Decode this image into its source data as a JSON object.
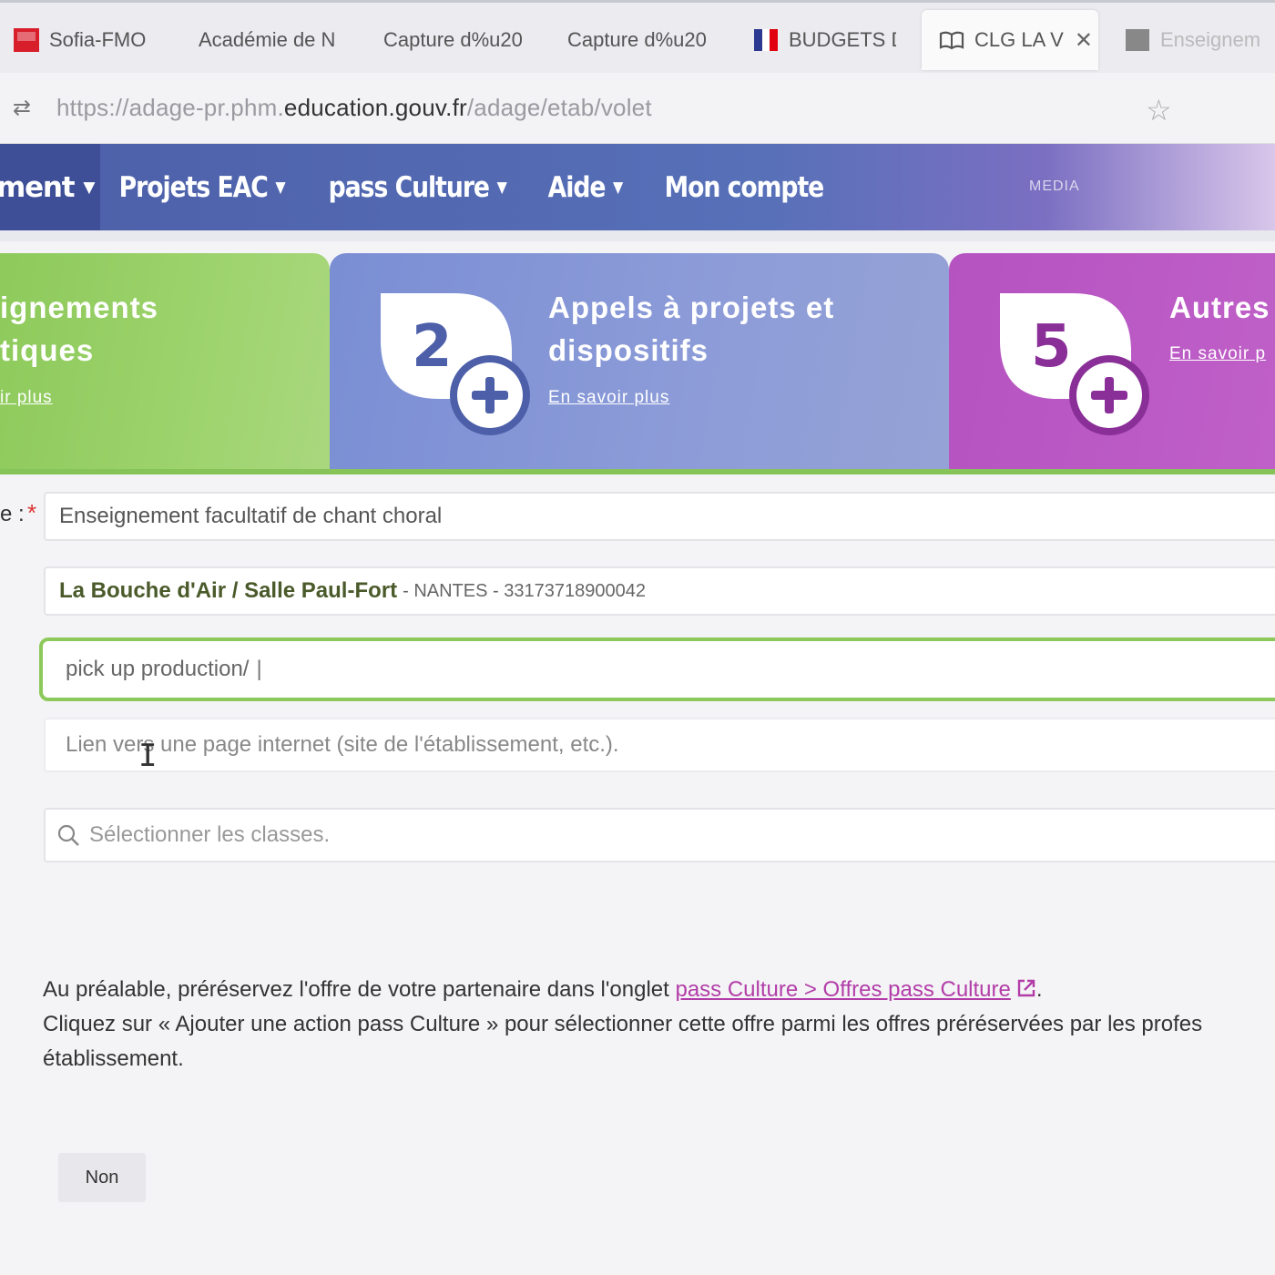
{
  "tabs": [
    {
      "label": "Sofia-FMO",
      "icon": "sofia-logo-icon",
      "active": false
    },
    {
      "label": "Académie de N",
      "icon": "",
      "active": false
    },
    {
      "label": "Capture d%u20",
      "icon": "",
      "active": false
    },
    {
      "label": "Capture d%u20",
      "icon": "",
      "active": false
    },
    {
      "label": "BUDGETS D",
      "icon": "french-flag-icon",
      "active": false
    },
    {
      "label": "CLG LA V",
      "icon": "book-icon",
      "active": true
    },
    {
      "label": "Enseignem",
      "icon": "page-icon",
      "active": false
    }
  ],
  "address": {
    "prefix": "https://adage-pr.phm.",
    "domain": "education.gouv.fr",
    "path": "/adage/etab/volet"
  },
  "nav": {
    "items": [
      "ment",
      "Projets EAC",
      "pass Culture",
      "Aide",
      "Mon compte"
    ],
    "user": "MEDIA"
  },
  "cards": {
    "green": {
      "title_line1": "ignements",
      "title_line2": "tiques",
      "more": "ir plus"
    },
    "blue": {
      "number": "2",
      "title_line1": "Appels à projets et",
      "title_line2": "dispositifs",
      "more": "En savoir plus"
    },
    "purple": {
      "number": "5",
      "title_line1": "Autres",
      "more": "En savoir p"
    }
  },
  "form": {
    "label_fragment": "e :",
    "required_mark": "*",
    "action_title": "Enseignement facultatif de chant choral",
    "partner_name": "La Bouche d'Air / Salle Paul-Fort",
    "partner_meta": "- NANTES - 33173718900042",
    "link_value": "pick up production/",
    "link_placeholder": "Lien vers une page internet (site de l'établissement, etc.).",
    "classes_placeholder": "Sélectionner les classes."
  },
  "info": {
    "line1_before": "Au préalable, préréservez l'offre de votre partenaire dans l'onglet ",
    "line1_link": "pass Culture > Offres pass Culture",
    "line1_after": ".",
    "line2": "Cliquez sur « Ajouter une action pass Culture » pour sélectionner cette offre parmi les offres préréservées par les profes",
    "line3": "établissement."
  },
  "buttons": {
    "no": "Non"
  },
  "colors": {
    "nav": "#4c5fa8",
    "green_card": "#8cc95a",
    "blue_card": "#7a8ed4",
    "purple_card": "#b553c1",
    "link": "#b23da8",
    "focus_border": "#8cc95a"
  }
}
